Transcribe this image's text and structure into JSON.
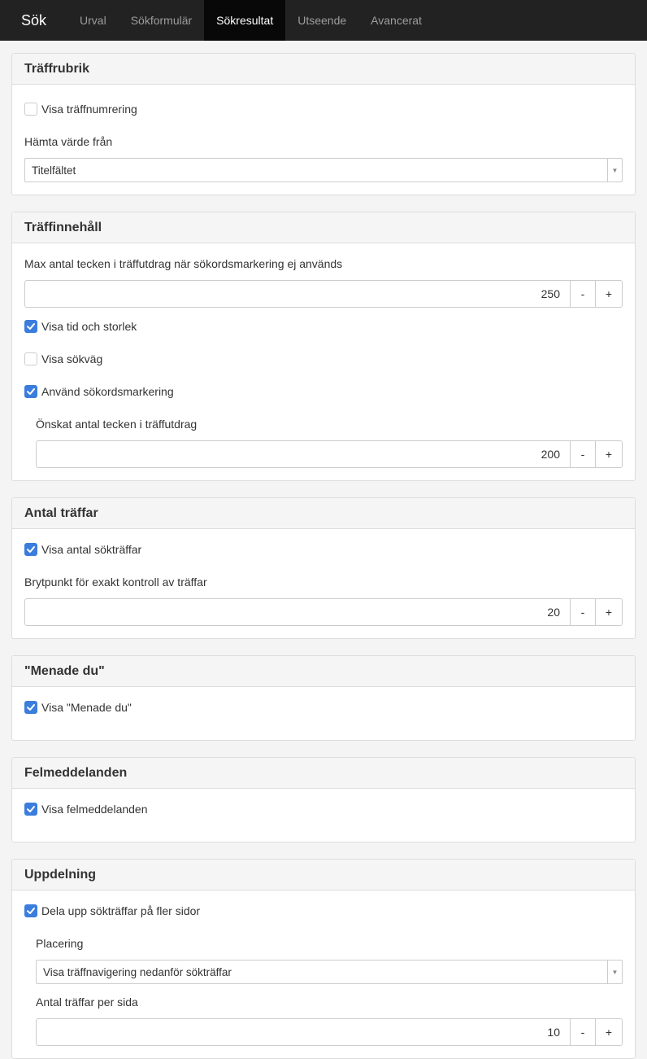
{
  "nav": {
    "brand": "Sök",
    "tabs": [
      {
        "label": "Urval"
      },
      {
        "label": "Sökformulär"
      },
      {
        "label": "Sökresultat"
      },
      {
        "label": "Utseende"
      },
      {
        "label": "Avancerat"
      }
    ],
    "active_tab": "Sökresultat"
  },
  "colors": {
    "navbar": "#222222",
    "active_tab_bg": "#080808",
    "checkbox_checked": "#3b7ddd"
  },
  "panels": {
    "traffrubrik": {
      "title": "Träffrubrik",
      "show_numbering": {
        "label": "Visa träffnumrering",
        "checked": false
      },
      "fetch_value_label": "Hämta värde från",
      "fetch_value_selected": "Titelfältet"
    },
    "traffinnehall": {
      "title": "Träffinnehåll",
      "max_chars_label": "Max antal tecken i träffutdrag när sökordsmarkering ej används",
      "max_chars_value": "250",
      "show_time_size": {
        "label": "Visa tid och storlek",
        "checked": true
      },
      "show_path": {
        "label": "Visa sökväg",
        "checked": false
      },
      "use_highlight": {
        "label": "Använd sökordsmarkering",
        "checked": true
      },
      "desired_chars_label": "Önskat antal tecken i träffutdrag",
      "desired_chars_value": "200"
    },
    "antal_traffar": {
      "title": "Antal träffar",
      "show_count": {
        "label": "Visa antal sökträffar",
        "checked": true
      },
      "breakpoint_label": "Brytpunkt för exakt kontroll av träffar",
      "breakpoint_value": "20"
    },
    "menade_du": {
      "title": "\"Menade du\"",
      "show_did_you_mean": {
        "label": "Visa \"Menade du\"",
        "checked": true
      }
    },
    "felmeddelanden": {
      "title": "Felmeddelanden",
      "show_errors": {
        "label": "Visa felmeddelanden",
        "checked": true
      }
    },
    "uppdelning": {
      "title": "Uppdelning",
      "paginate": {
        "label": "Dela upp sökträffar på fler sidor",
        "checked": true
      },
      "placement_label": "Placering",
      "placement_selected": "Visa träffnavigering nedanför sökträffar",
      "per_page_label": "Antal träffar per sida",
      "per_page_value": "10"
    }
  },
  "stepper": {
    "minus": "-",
    "plus": "+"
  }
}
